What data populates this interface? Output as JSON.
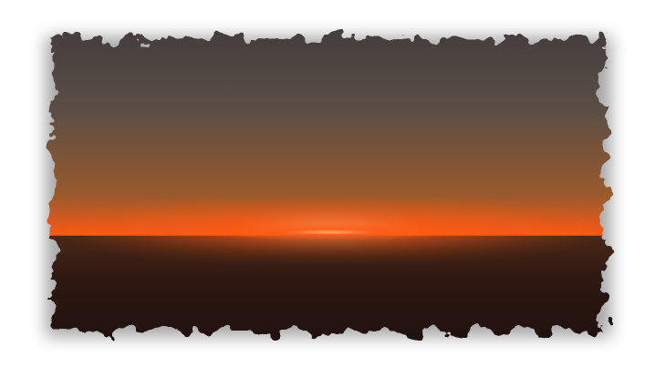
{
  "scene": {
    "kind": "sunset-horizon-photo",
    "frame_style": "torn-grunge-edge",
    "palette": {
      "background": "#ffffff",
      "sky_top": "#3e3a3c",
      "sky_mid": "#5c4e46",
      "sky_warm": "#9a5a2c",
      "horizon_glow": "#ff5a14",
      "horizon_core": "#ffb070",
      "ground_top": "#4a2818",
      "ground_mid": "#2e1812",
      "ground_bottom": "#1c0f0d",
      "edge_shadow": "#000000"
    }
  }
}
